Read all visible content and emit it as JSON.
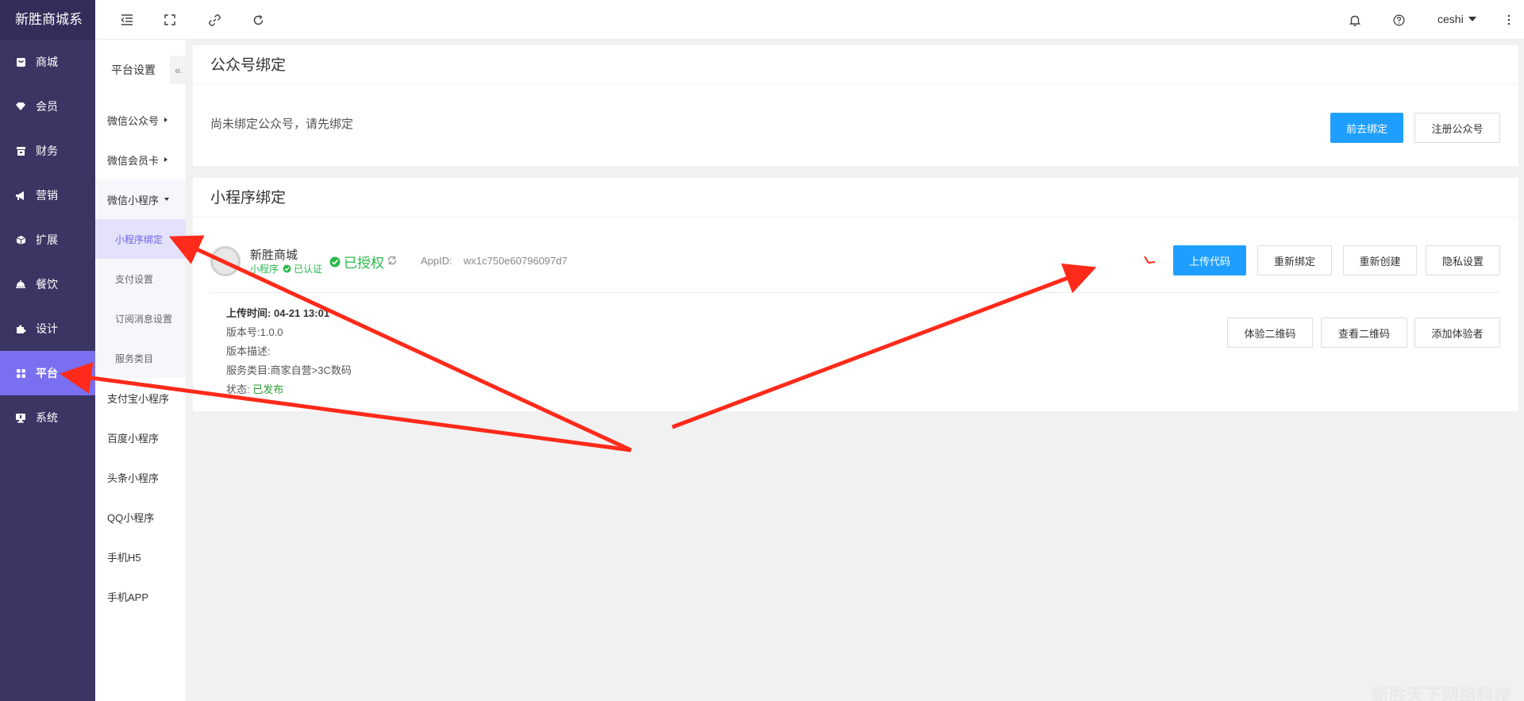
{
  "app": {
    "brand": "新胜商城系"
  },
  "sidebar": {
    "items": [
      {
        "label": "商城",
        "icon": "shop-bag-icon",
        "active": false
      },
      {
        "label": "会员",
        "icon": "member-diamond-icon",
        "active": false
      },
      {
        "label": "财务",
        "icon": "finance-icon",
        "active": false
      },
      {
        "label": "营销",
        "icon": "megaphone-icon",
        "active": false
      },
      {
        "label": "扩展",
        "icon": "cube-icon",
        "active": false
      },
      {
        "label": "餐饮",
        "icon": "food-cloche-icon",
        "active": false
      },
      {
        "label": "设计",
        "icon": "puzzle-icon",
        "active": false
      },
      {
        "label": "平台",
        "icon": "grid-icon",
        "active": true
      },
      {
        "label": "系统",
        "icon": "monitor-icon",
        "active": false
      }
    ]
  },
  "subnav": {
    "title": "平台设置",
    "collapse_glyph": "«",
    "groups": {
      "wechat_oa": "微信公众号",
      "wechat_card": "微信会员卡",
      "wechat_mini": "微信小程序",
      "alipay": "支付宝小程序",
      "baidu": "百度小程序",
      "toutiao": "头条小程序",
      "qq": "QQ小程序",
      "h5": "手机H5",
      "app": "手机APP"
    },
    "mini_items": {
      "binding": "小程序绑定",
      "payment": "支付设置",
      "subscribe": "订阅消息设置",
      "category": "服务类目"
    }
  },
  "header": {
    "username": "ceshi",
    "icons": [
      "menu-fold-icon",
      "fullscreen-icon",
      "link-icon",
      "refresh-icon",
      "bell-icon",
      "help-icon",
      "more-vertical-icon"
    ]
  },
  "oa_card": {
    "title": "公众号绑定",
    "message": "尚未绑定公众号，请先绑定",
    "bind_btn": "前去绑定",
    "register_btn": "注册公众号"
  },
  "mini_card": {
    "title": "小程序绑定",
    "app_name": "新胜商城",
    "app_type": "小程序",
    "verified": "已认证",
    "authorized": "已授权",
    "appid_label": "AppID:",
    "appid": "wx1c750e60796097d7",
    "upload_btn": "上传代码",
    "rebind_btn": "重新绑定",
    "recreate_btn": "重新创建",
    "privacy_btn": "隐私设置",
    "trial_qr_btn": "体验二维码",
    "view_qr_btn": "查看二维码",
    "add_tester_btn": "添加体验者",
    "upload_time_label": "上传时间:",
    "upload_time": "04-21 13:01",
    "version_label": "版本号:",
    "version": "1.0.0",
    "desc_label": "版本描述:",
    "category_label": "服务类目:",
    "category": "商家自营>3C数码",
    "status_label": "状态:",
    "status": "已发布"
  },
  "watermark": "新胜天下网络科技",
  "colors": {
    "sidebar_bg": "#3a3562",
    "sidebar_active": "#7a6ff0",
    "primary": "#1e9fff",
    "success": "#2db84d",
    "annotation": "#ff2a1a"
  }
}
